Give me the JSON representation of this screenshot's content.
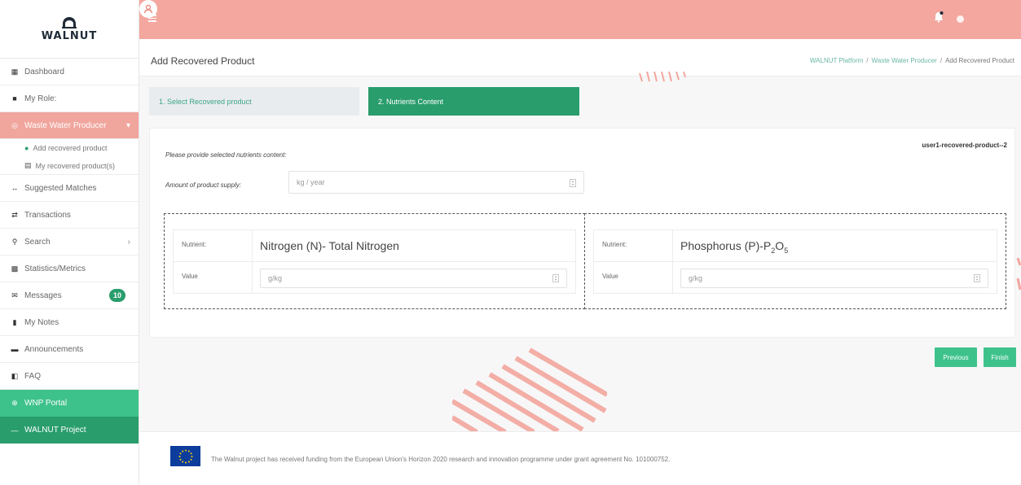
{
  "brand": {
    "name": "WALNUT"
  },
  "sidebar": {
    "items": [
      {
        "label": "Dashboard",
        "icon": "dashboard-icon"
      },
      {
        "label": "My Role:",
        "icon": "briefcase-icon"
      },
      {
        "label": "Waste Water Producer",
        "icon": "target-icon",
        "active": true
      },
      {
        "label": "Suggested Matches",
        "icon": "arrows-icon"
      },
      {
        "label": "Transactions",
        "icon": "exchange-icon"
      },
      {
        "label": "Search",
        "icon": "search-icon"
      },
      {
        "label": "Statistics/Metrics",
        "icon": "chart-icon"
      },
      {
        "label": "Messages",
        "icon": "envelope-icon",
        "badge": "10"
      },
      {
        "label": "My Notes",
        "icon": "bookmark-icon"
      },
      {
        "label": "Announcements",
        "icon": "newspaper-icon"
      },
      {
        "label": "FAQ",
        "icon": "book-icon"
      },
      {
        "label": "WNP Portal",
        "icon": "globe-icon"
      },
      {
        "label": "WALNUT Project",
        "icon": "dash-icon"
      }
    ],
    "sub_items": [
      {
        "label": "Add recovered product",
        "icon": "plus-circle-icon"
      },
      {
        "label": "My recovered product(s)",
        "icon": "table-icon"
      }
    ]
  },
  "page": {
    "title": "Add Recovered Product",
    "breadcrumb": [
      "WALNUT Platform",
      "Waste Water Producer",
      "Add Recovered Product"
    ]
  },
  "steps": [
    {
      "label": "1. Select Recovered product"
    },
    {
      "label": "2. Nutrients Content"
    }
  ],
  "form": {
    "product_id": "user1-recovered-product--2",
    "instructions": "Please provide selected nutrients content:",
    "supply_label": "Amount of product supply:",
    "supply_placeholder": "kg / year",
    "nutrient_label": "Nutrient:",
    "value_label": "Value",
    "nutrients": [
      {
        "name": "Nitrogen (N)- Total Nitrogen",
        "value_placeholder": "g/kg"
      },
      {
        "name_prefix": "Phosphorus (P)-P",
        "sub1": "2",
        "mid": "O",
        "sub2": "5",
        "value_placeholder": "g/kg"
      }
    ]
  },
  "buttons": {
    "previous": "Previous",
    "finish": "Finish"
  },
  "footer": {
    "text": "The Walnut project has received funding from the European Union's Horizon 2020 research and innovation programme under grant agreement No. 101000752."
  },
  "colors": {
    "accent_pink": "#f3a79e",
    "green": "#2a9d6d",
    "light_green": "#3ec28b"
  }
}
